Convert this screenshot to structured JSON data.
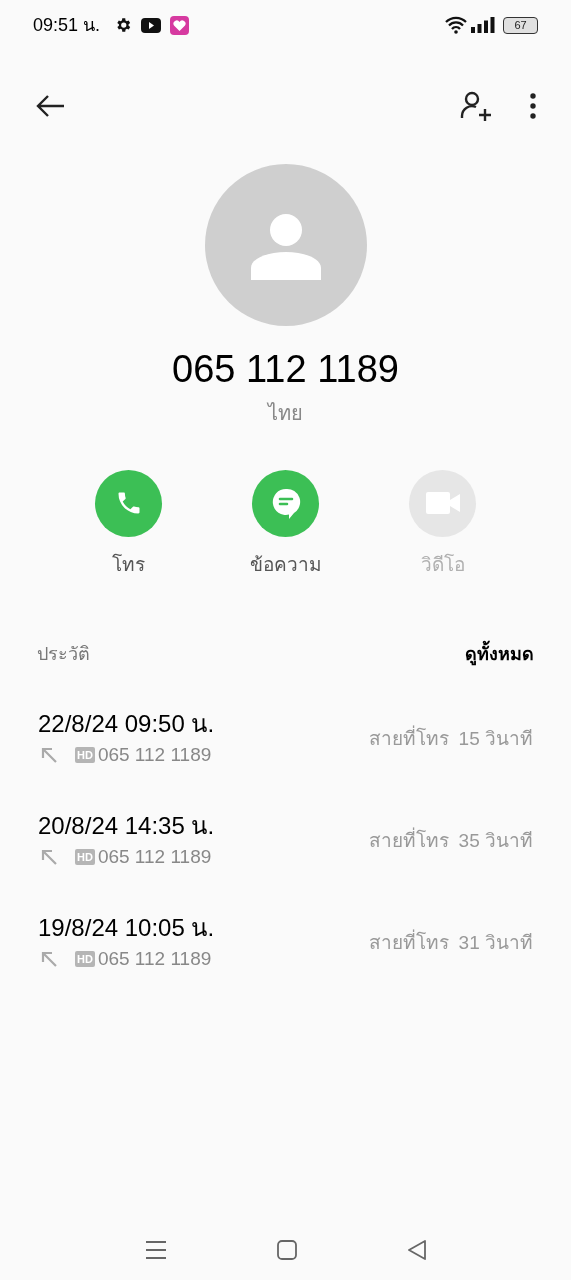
{
  "status_bar": {
    "time": "09:51 น.",
    "battery": "67"
  },
  "contact": {
    "number": "065 112 1189",
    "country": "ไทย"
  },
  "actions": [
    {
      "kind": "call",
      "label": "โทร",
      "disabled": false
    },
    {
      "kind": "message",
      "label": "ข้อความ",
      "disabled": false
    },
    {
      "kind": "video",
      "label": "วิดีโอ",
      "disabled": true
    }
  ],
  "history": {
    "title": "ประวัติ",
    "see_all": "ดูทั้งหมด",
    "rows": [
      {
        "datetime": "22/8/24 09:50 น.",
        "badge": "HD",
        "number": "065 112 1189",
        "type": "สายที่โทร",
        "duration": "15 วินาที"
      },
      {
        "datetime": "20/8/24 14:35 น.",
        "badge": "HD",
        "number": "065 112 1189",
        "type": "สายที่โทร",
        "duration": "35 วินาที"
      },
      {
        "datetime": "19/8/24 10:05 น.",
        "badge": "HD",
        "number": "065 112 1189",
        "type": "สายที่โทร",
        "duration": "31 วินาที"
      }
    ]
  }
}
